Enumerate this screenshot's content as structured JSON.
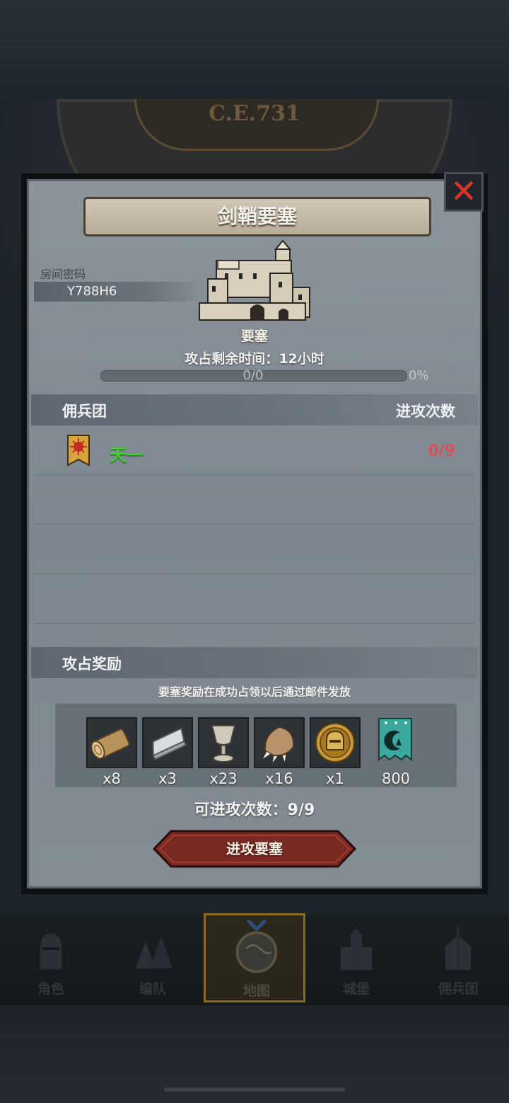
{
  "header": {
    "era": "C.E.731"
  },
  "dialog": {
    "title": "剑鞘要塞",
    "close_icon": "close-icon",
    "room": {
      "label": "房间密码",
      "code": "Y788H6"
    },
    "fortress": {
      "icon": "castle-icon",
      "label": "要塞"
    },
    "time_remaining": "攻占剩余时间：12小时",
    "progress": {
      "text": "0/0",
      "percent_text": "0%",
      "fraction": 0
    },
    "mercenaries": {
      "header": "佣兵团",
      "count_header": "进攻次数",
      "rows": [
        {
          "banner_icon": "sun-banner-icon",
          "name": "天一",
          "attacks": "0/9"
        }
      ]
    },
    "rewards": {
      "header": "攻占奖励",
      "note": "要塞奖励在成功占领以后通过邮件发放",
      "items": [
        {
          "icon": "wood-log-icon",
          "qty": "x8"
        },
        {
          "icon": "iron-ingot-icon",
          "qty": "x3"
        },
        {
          "icon": "goblet-icon",
          "qty": "x23"
        },
        {
          "icon": "beast-claw-icon",
          "qty": "x16"
        },
        {
          "icon": "knight-medal-icon",
          "qty": "x1"
        },
        {
          "icon": "guild-banner-icon",
          "qty": "800"
        }
      ]
    },
    "attacks_available": "可进攻次数：9/9",
    "attack_button": "进攻要塞",
    "colors": {
      "merc_name": "#3fd033",
      "attacks": "#d9505a",
      "close": "#d8362b",
      "button": "#7a2a22"
    }
  },
  "nav": {
    "items": [
      {
        "icon": "knight-helmet-icon",
        "label": "角色",
        "active": false
      },
      {
        "icon": "formation-icon",
        "label": "编队",
        "active": false
      },
      {
        "icon": "map-globe-icon",
        "label": "地图",
        "active": true
      },
      {
        "icon": "castle-tower-icon",
        "label": "城堡",
        "active": false
      },
      {
        "icon": "mercenary-icon",
        "label": "佣兵团",
        "active": false
      }
    ]
  }
}
